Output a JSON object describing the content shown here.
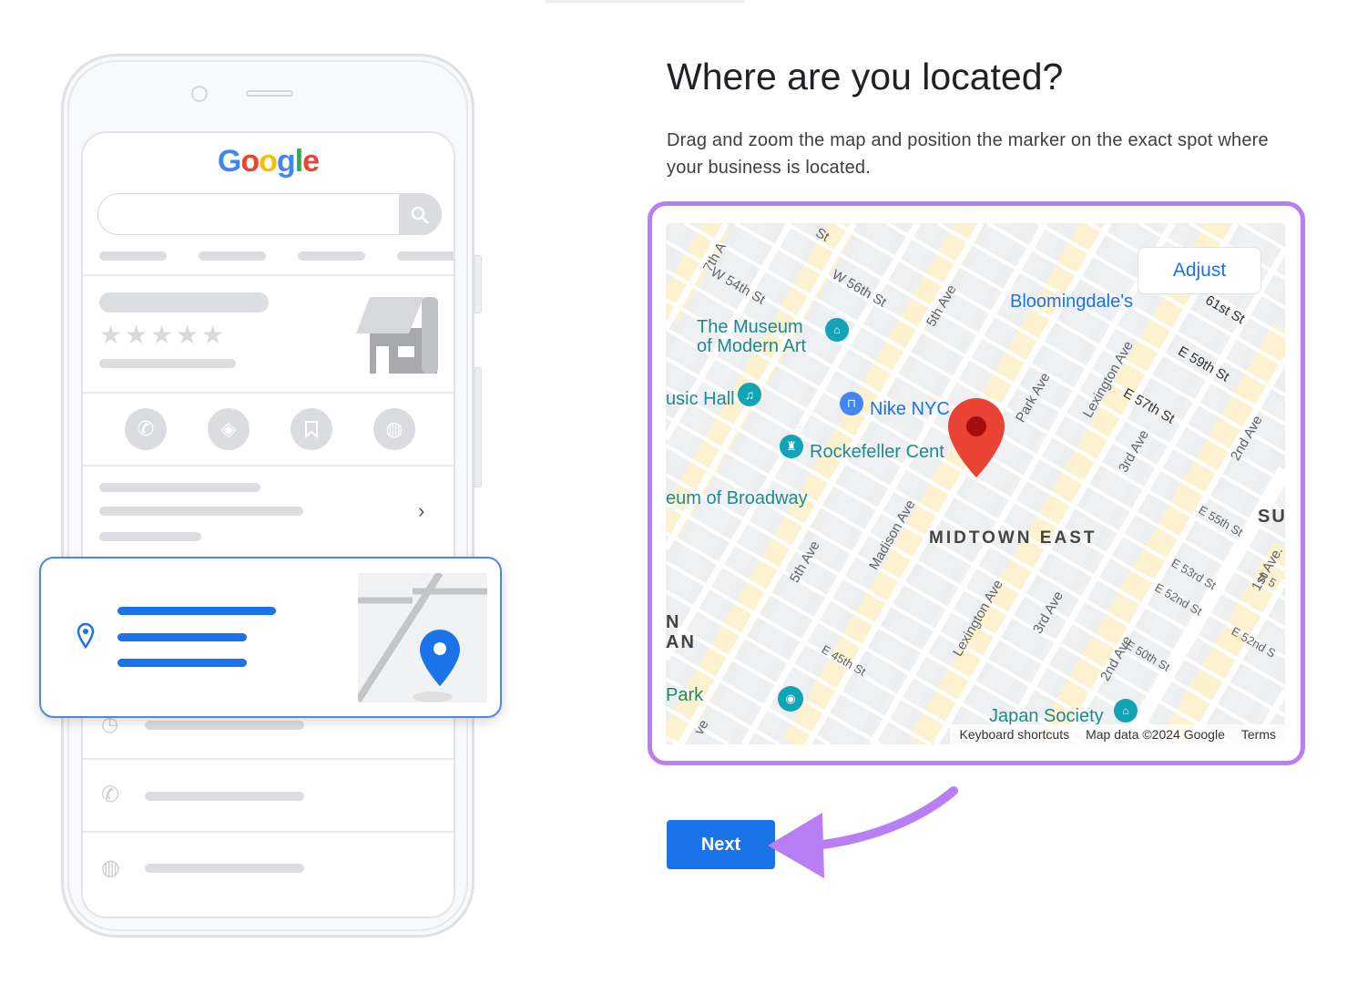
{
  "phone": {
    "logo": "Google",
    "logo_colors": [
      "#4285F4",
      "#EA4335",
      "#FBBC05",
      "#4285F4",
      "#34A853",
      "#EA4335"
    ],
    "rating_stars": 5,
    "action_icons": [
      "phone-icon",
      "directions-icon",
      "bookmark-icon",
      "globe-icon"
    ]
  },
  "page": {
    "title": "Where are you located?",
    "description": "Drag and zoom the map and position the marker on the exact spot where your business is located."
  },
  "map": {
    "adjust_label": "Adjust",
    "area_label": "MIDTOWN EAST",
    "pois": {
      "moma_1": "The Museum",
      "moma_2": "of Modern Art",
      "music_hall": "usic Hall",
      "nike": "Nike NYC",
      "rockefeller": "Rockefeller Cent",
      "broadway": "eum of Broadway",
      "bloomingdales": "Bloomingdale's",
      "japan": "Japan Society",
      "park": "Park",
      "su": "SU",
      "n": "N",
      "an": "AN"
    },
    "streets": {
      "s1": "7th A",
      "s2": "W 54th St",
      "s3": "W 56th St",
      "s4": "5th Ave",
      "s5": "Park Ave",
      "s6": "Lexington Ave",
      "s7": "61st St",
      "s8": "E 59th St",
      "s9": "E 57th St",
      "s10": "3rd Ave",
      "s11": "2nd Ave",
      "s12": "Madison Ave",
      "s13": "5th Ave",
      "s14": "Lexington Ave",
      "s15": "3rd Ave",
      "s16": "2nd Ave",
      "s17": "E 55th St",
      "s18": "1st Ave.",
      "s19": "E 53rd St",
      "s20": "E 52nd St",
      "s21": "E 50th St",
      "s22": "E 52nd S",
      "s23": "E 45th St",
      "s24": "St",
      "s25": "ve",
      "s26": "E 5"
    },
    "attribution": {
      "shortcuts": "Keyboard shortcuts",
      "data": "Map data ©2024 Google",
      "terms": "Terms"
    },
    "marker_color": "#EA4335"
  },
  "actions": {
    "next_label": "Next"
  },
  "colors": {
    "accent": "#1a73e8",
    "highlight": "#b77ff3"
  }
}
